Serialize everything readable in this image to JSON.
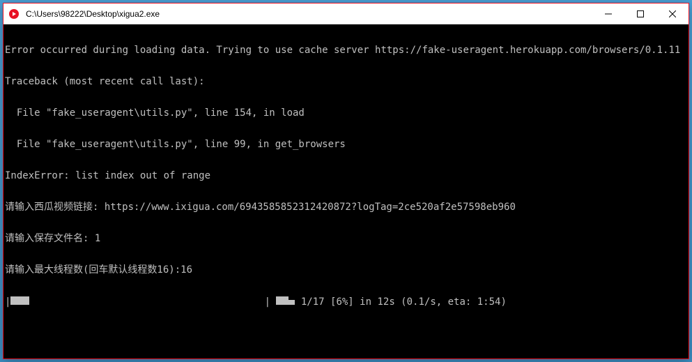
{
  "window": {
    "title": "C:\\Users\\98222\\Desktop\\xigua2.exe",
    "icon_accent": "#e81123"
  },
  "console": {
    "lines": [
      "Error occurred during loading data. Trying to use cache server https://fake-useragent.herokuapp.com/browsers/0.1.11",
      "Traceback (most recent call last):",
      "  File \"fake_useragent\\utils.py\", line 154, in load",
      "  File \"fake_useragent\\utils.py\", line 99, in get_browsers",
      "IndexError: list index out of range",
      "请输入西瓜视频链接: https://www.ixigua.com/6943585852312420872?logTag=2ce520af2e57598eb960",
      "请输入保存文件名: 1",
      "请输入最大线程数(回车默认线程数16):16"
    ],
    "progress": {
      "left_bar_chars": 3,
      "mid_bar_chars_full": 2,
      "mid_bar_chars_half": 1,
      "current": 1,
      "total": 17,
      "percent": 6,
      "elapsed": "12s",
      "rate": "0.1/s",
      "eta": "1:54",
      "text_after": " 1/17 [6%] in 12s (0.1/s, eta: 1:54)"
    }
  }
}
